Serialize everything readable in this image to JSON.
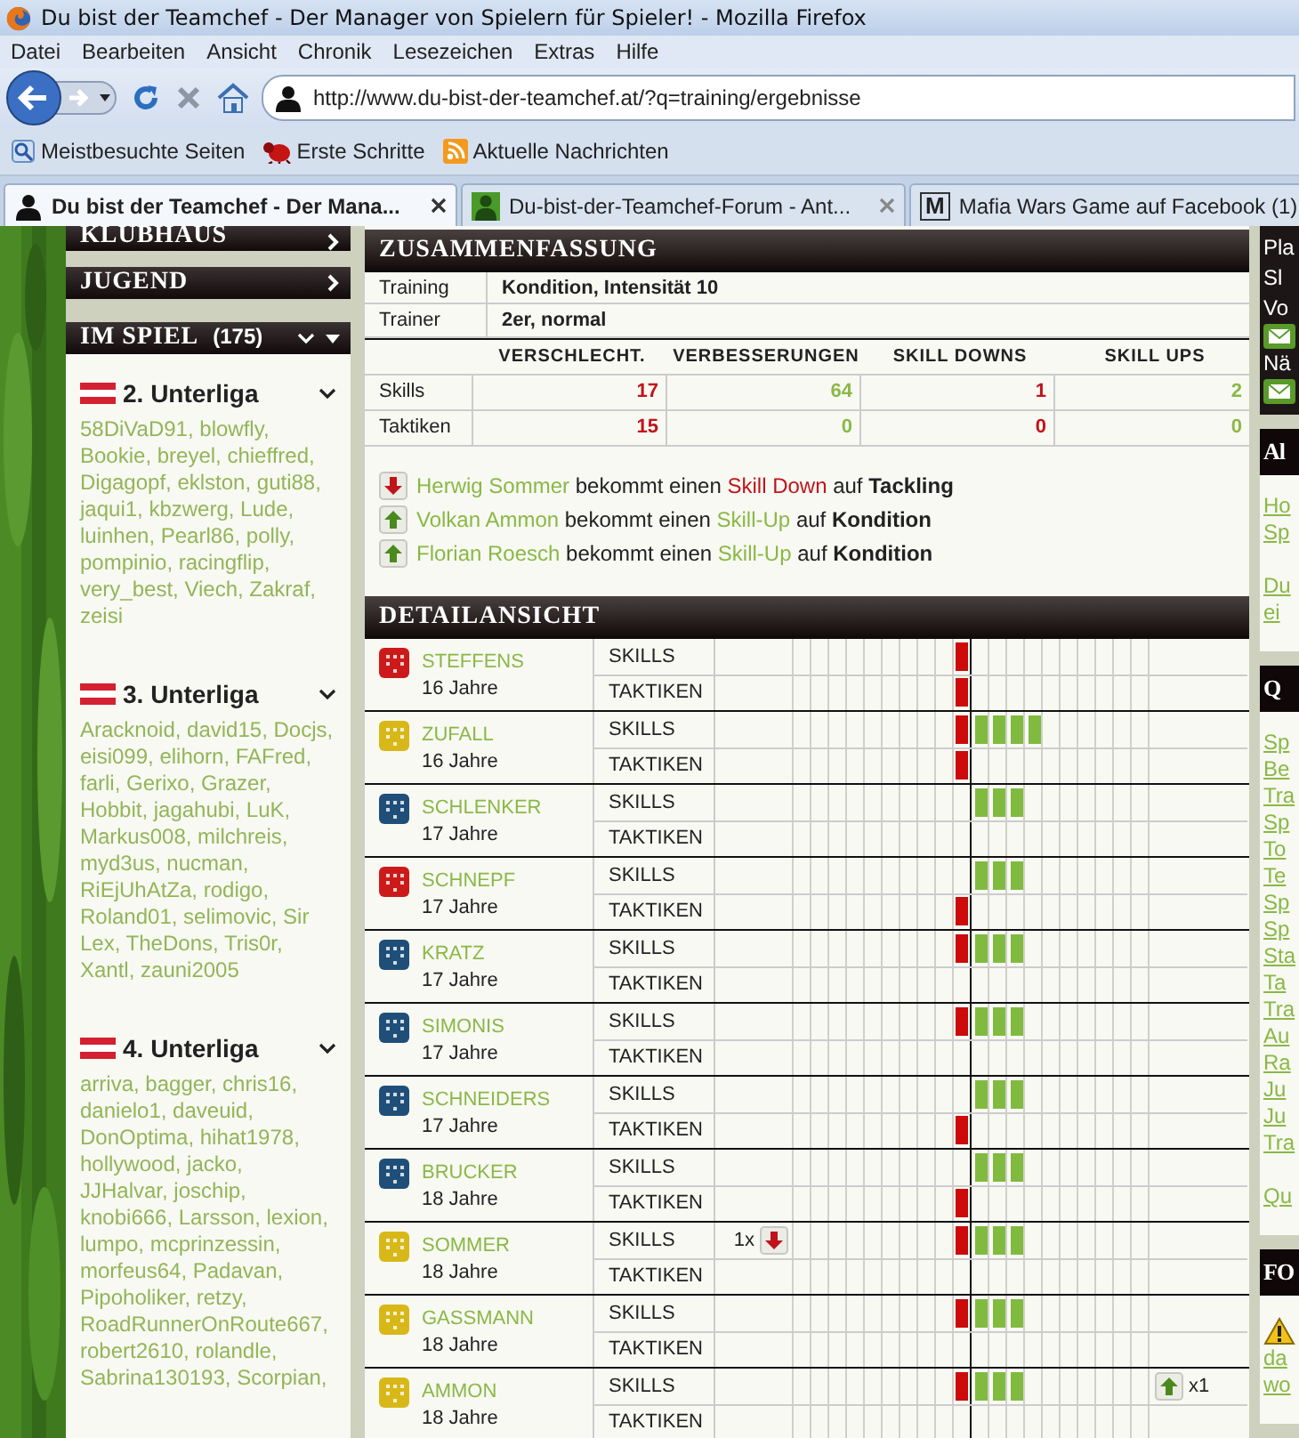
{
  "window": {
    "title": "Du bist der Teamchef - Der Manager von Spielern für Spieler! - Mozilla Firefox"
  },
  "menu": [
    "Datei",
    "Bearbeiten",
    "Ansicht",
    "Chronik",
    "Lesezeichen",
    "Extras",
    "Hilfe"
  ],
  "address": {
    "url": "http://www.du-bist-der-teamchef.at/?q=training/ergebnisse"
  },
  "bookmarks": [
    {
      "label": "Meistbesuchte Seiten",
      "kind": "search"
    },
    {
      "label": "Erste Schritte",
      "kind": "bug"
    },
    {
      "label": "Aktuelle Nachrichten",
      "kind": "rss"
    }
  ],
  "tabs": [
    {
      "label": "Du bist der Teamchef - Der Mana...",
      "selected": true,
      "kind": "person",
      "closable": true
    },
    {
      "label": "Du-bist-der-Teamchef-Forum - Ant...",
      "selected": false,
      "kind": "person-green",
      "closable": true
    },
    {
      "label": "Mafia Wars Game auf Facebook (1)",
      "selected": false,
      "kind": "letter",
      "icon_text": "M",
      "closable": false
    }
  ],
  "sidebar": {
    "menu": [
      "KLUBHAUS",
      "JUGEND"
    ],
    "in_game": {
      "title": "IM SPIEL",
      "count": "(175)"
    },
    "leagues": [
      {
        "name": "2. Unterliga",
        "players": "58DiVaD91, blowfly, Bookie, breyel, chieffred, Digagopf, eklston, guti88, jaqui1, kbzwerg, Lude, luinhen, Pearl86, polly, pompinio, racingflip, very_best, Viech, Zakraf, zeisi"
      },
      {
        "name": "3. Unterliga",
        "players": "Aracknoid, david15, Docjs, eisi099, elihorn, FAFred, farli, Gerixo, Grazer, Hobbit, jagahubi, LuK, Markus008, milchreis, myd3us, nucman, RiEjUhAtZa, rodigo, Roland01, selimovic, Sir Lex, TheDons, Tris0r, Xantl, zauni2005"
      },
      {
        "name": "4. Unterliga",
        "players": "arriva, bagger, chris16, danielo1, daveuid, DonOptima, hihat1978, hollywood, jacko, JJHalvar, joschip, knobi666, Larsson, lexion, lumpo, mcprinzessin, morfeus64, Padavan, Pipoholiker, retzy, RoadRunnerOnRoute667, robert2610, rolandle, Sabrina130193, Scorpian,"
      }
    ]
  },
  "summary": {
    "title": "ZUSAMMENFASSUNG",
    "info": [
      {
        "label": "Training",
        "value": "Kondition, Intensität 10"
      },
      {
        "label": "Trainer",
        "value": "2er, normal"
      }
    ],
    "columns": [
      {
        "label": "VERSCHLECHT.",
        "kind": "down"
      },
      {
        "label": "VERBESSERUNGEN",
        "kind": "up"
      },
      {
        "label": "SKILL DOWNS",
        "kind": "down"
      },
      {
        "label": "SKILL UPS",
        "kind": "up"
      }
    ],
    "rows": [
      {
        "label": "Skills",
        "values": [
          "17",
          "64",
          "1",
          "2"
        ]
      },
      {
        "label": "Taktiken",
        "values": [
          "15",
          "0",
          "0",
          "0"
        ]
      }
    ],
    "events": [
      {
        "kind": "down",
        "player": "Herwig Sommer",
        "middle": " bekommt einen ",
        "change": "Skill Down",
        "prep": " auf ",
        "skill": "Tackling"
      },
      {
        "kind": "up",
        "player": "Volkan Ammon",
        "middle": " bekommt einen ",
        "change": "Skill-Up",
        "prep": " auf ",
        "skill": "Kondition"
      },
      {
        "kind": "up",
        "player": "Florian Roesch",
        "middle": " bekommt einen ",
        "change": "Skill-Up",
        "prep": " auf ",
        "skill": "Kondition"
      }
    ]
  },
  "detail": {
    "title": "DETAILANSICHT",
    "players": [
      {
        "name": "STEFFENS",
        "age": "16 Jahre",
        "color": "#cc1a1a",
        "rows": [
          {
            "label": "SKILLS",
            "changes": [
              {
                "kind": "down"
              }
            ]
          },
          {
            "label": "TAKTIKEN",
            "changes": [
              {
                "kind": "down"
              }
            ]
          }
        ]
      },
      {
        "name": "ZUFALL",
        "age": "16 Jahre",
        "color": "#d8b818",
        "rows": [
          {
            "label": "SKILLS",
            "changes": [
              {
                "kind": "down"
              },
              {
                "kind": "up"
              },
              {
                "kind": "up"
              },
              {
                "kind": "up"
              },
              {
                "kind": "up"
              }
            ]
          },
          {
            "label": "TAKTIKEN",
            "changes": [
              {
                "kind": "down"
              }
            ]
          }
        ]
      },
      {
        "name": "SCHLENKER",
        "age": "17 Jahre",
        "color": "#1f4f78",
        "rows": [
          {
            "label": "SKILLS",
            "changes": [
              {
                "kind": "up"
              },
              {
                "kind": "up"
              },
              {
                "kind": "up"
              }
            ]
          },
          {
            "label": "TAKTIKEN"
          }
        ]
      },
      {
        "name": "SCHNEPF",
        "age": "17 Jahre",
        "color": "#cc1a1a",
        "rows": [
          {
            "label": "SKILLS",
            "changes": [
              {
                "kind": "up"
              },
              {
                "kind": "up"
              },
              {
                "kind": "up"
              }
            ]
          },
          {
            "label": "TAKTIKEN",
            "changes": [
              {
                "kind": "down"
              }
            ]
          }
        ]
      },
      {
        "name": "KRATZ",
        "age": "17 Jahre",
        "color": "#1f4f78",
        "rows": [
          {
            "label": "SKILLS",
            "changes": [
              {
                "kind": "down"
              },
              {
                "kind": "up"
              },
              {
                "kind": "up"
              },
              {
                "kind": "up"
              }
            ]
          },
          {
            "label": "TAKTIKEN"
          }
        ]
      },
      {
        "name": "SIMONIS",
        "age": "17 Jahre",
        "color": "#1f4f78",
        "rows": [
          {
            "label": "SKILLS",
            "changes": [
              {
                "kind": "down"
              },
              {
                "kind": "up"
              },
              {
                "kind": "up"
              },
              {
                "kind": "up"
              }
            ]
          },
          {
            "label": "TAKTIKEN"
          }
        ]
      },
      {
        "name": "SCHNEIDERS",
        "age": "17 Jahre",
        "color": "#1f4f78",
        "rows": [
          {
            "label": "SKILLS",
            "changes": [
              {
                "kind": "up"
              },
              {
                "kind": "up"
              },
              {
                "kind": "up"
              }
            ]
          },
          {
            "label": "TAKTIKEN",
            "changes": [
              {
                "kind": "down"
              }
            ]
          }
        ]
      },
      {
        "name": "BRUCKER",
        "age": "18 Jahre",
        "color": "#1f4f78",
        "rows": [
          {
            "label": "SKILLS",
            "changes": [
              {
                "kind": "up"
              },
              {
                "kind": "up"
              },
              {
                "kind": "up"
              }
            ]
          },
          {
            "label": "TAKTIKEN",
            "changes": [
              {
                "kind": "down"
              }
            ]
          }
        ]
      },
      {
        "name": "SOMMER",
        "age": "18 Jahre",
        "color": "#d8b818",
        "rows": [
          {
            "label": "SKILLS",
            "changes": [
              {
                "kind": "down"
              },
              {
                "kind": "up"
              },
              {
                "kind": "up"
              },
              {
                "kind": "up"
              }
            ],
            "marker": {
              "kind": "down",
              "count": "1x"
            }
          },
          {
            "label": "TAKTIKEN"
          }
        ]
      },
      {
        "name": "GASSMANN",
        "age": "18 Jahre",
        "color": "#d8b818",
        "rows": [
          {
            "label": "SKILLS",
            "changes": [
              {
                "kind": "down"
              },
              {
                "kind": "up"
              },
              {
                "kind": "up"
              },
              {
                "kind": "up"
              }
            ]
          },
          {
            "label": "TAKTIKEN"
          }
        ]
      },
      {
        "name": "AMMON",
        "age": "18 Jahre",
        "color": "#d8b818",
        "rows": [
          {
            "label": "SKILLS",
            "changes": [
              {
                "kind": "down"
              },
              {
                "kind": "up"
              },
              {
                "kind": "up"
              },
              {
                "kind": "up"
              }
            ],
            "marker": {
              "kind": "up",
              "count": "x1"
            }
          },
          {
            "label": "TAKTIKEN"
          }
        ]
      }
    ]
  },
  "right_panel": {
    "items": [
      {
        "text": "Pla",
        "mail": false
      },
      {
        "text": "Sl",
        "mail": false
      },
      {
        "text": "Vo",
        "mail": true
      },
      {
        "text": "Nä",
        "mail": true
      }
    ],
    "sections": [
      {
        "title": "Al",
        "warning": false,
        "groups": [
          [
            "Ho",
            "Sp"
          ],
          [
            "Du",
            "ei"
          ]
        ]
      },
      {
        "title": "Q",
        "warning": false,
        "groups": [
          [
            "Sp",
            "Be",
            "Tra",
            "Sp",
            "To",
            "Te",
            "Sp",
            "Sp",
            "Sta",
            "Ta",
            "Tra",
            "Au",
            "Ra",
            "Ju",
            "Ju",
            "Tra"
          ],
          [
            "Qu"
          ]
        ]
      },
      {
        "title": "FO",
        "warning": true,
        "groups": [
          [
            "da",
            "wo"
          ]
        ]
      }
    ]
  }
}
